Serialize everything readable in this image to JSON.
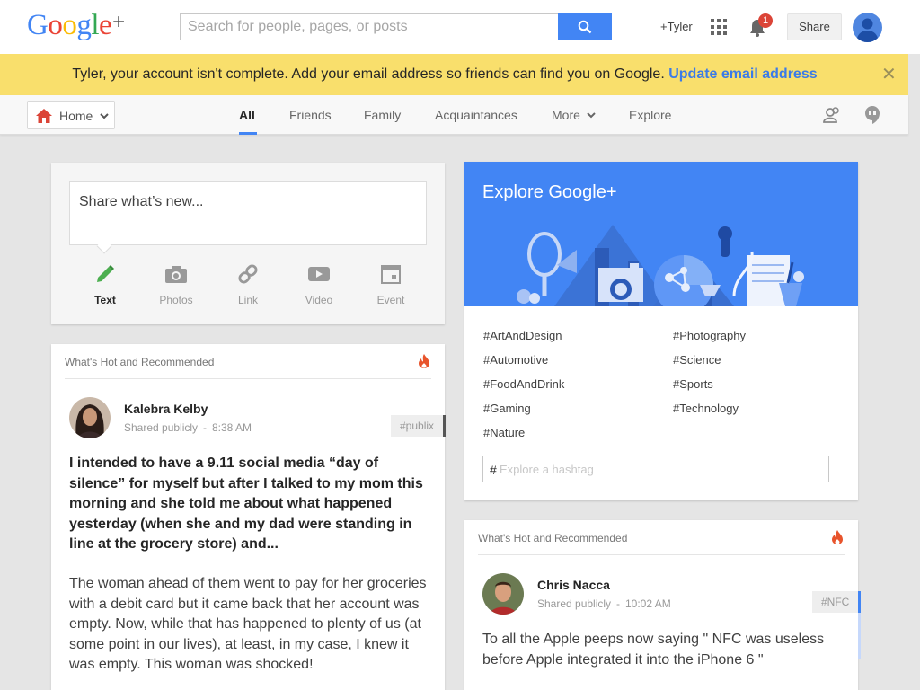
{
  "header": {
    "logo_text": "Google",
    "logo_plus": "+",
    "search_placeholder": "Search for people, pages, or posts",
    "profile_link": "+Tyler",
    "notification_count": "1",
    "share_label": "Share"
  },
  "banner": {
    "message": "Tyler, your account isn't complete. Add your email address so friends can find you on Google. ",
    "link": "Update email address",
    "close": "✕"
  },
  "nav": {
    "home_label": "Home",
    "tabs": [
      {
        "label": "All",
        "active": true
      },
      {
        "label": "Friends"
      },
      {
        "label": "Family"
      },
      {
        "label": "Acquaintances"
      },
      {
        "label": "More"
      },
      {
        "label": "Explore"
      }
    ]
  },
  "share_card": {
    "prompt": "Share what’s new...",
    "options": [
      {
        "label": "Text",
        "icon": "pencil-icon",
        "color": "#4caf50"
      },
      {
        "label": "Photos",
        "icon": "camera-icon"
      },
      {
        "label": "Link",
        "icon": "link-icon"
      },
      {
        "label": "Video",
        "icon": "video-icon"
      },
      {
        "label": "Event",
        "icon": "event-icon"
      }
    ]
  },
  "posts": [
    {
      "section_title": "What's Hot and Recommended",
      "author": "Kalebra Kelby",
      "visibility": "Shared publicly",
      "separator": "-",
      "time": "8:38 AM",
      "hashtag": "#publix",
      "paragraph_bold": "I intended to have a 9.11 social media “day of silence” for myself but after I talked to my mom this morning and she told me about what happened yesterday (when she and my dad were standing in line at the grocery store) and...",
      "paragraph": "The woman ahead of them went to pay for her groceries with a debit card but it came back that her account was empty. Now, while that has happened to plenty of us (at some point in our lives), at least, in my case, I knew it was empty. This woman was shocked!"
    },
    {
      "section_title": "What's Hot and Recommended",
      "author": "Chris Nacca",
      "visibility": "Shared publicly",
      "separator": "-",
      "time": "10:02 AM",
      "hashtag": "#NFC",
      "paragraph": "To all the Apple peeps now saying  \" NFC was useless before Apple integrated it into the iPhone 6 \""
    }
  ],
  "explore": {
    "title": "Explore Google+",
    "hashtags_left": [
      "#ArtAndDesign",
      "#Automotive",
      "#FoodAndDrink",
      "#Gaming",
      "#Nature"
    ],
    "hashtags_right": [
      "#Photography",
      "#Science",
      "#Sports",
      "#Technology"
    ],
    "input_prefix": "#",
    "input_placeholder": "Explore a hashtag"
  },
  "colors": {
    "accent": "#4285f4",
    "banner": "#f9df6c",
    "link": "#3b7be8",
    "badge": "#db4437",
    "fire": "#e8542c"
  }
}
